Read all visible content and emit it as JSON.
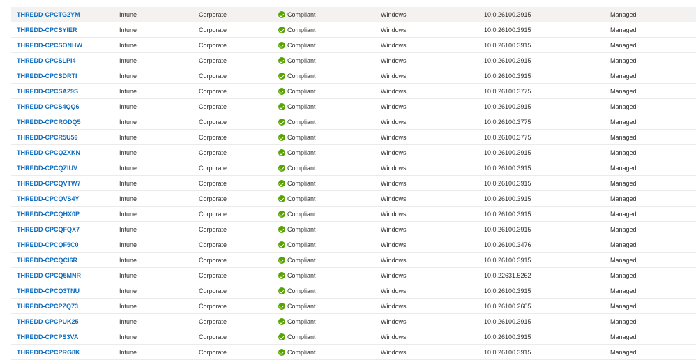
{
  "colors": {
    "link": "#0f6cbd",
    "compliant": "#57a300",
    "selected_row": "#f3f2f1"
  },
  "status_icon": "check-circle-icon",
  "rows": [
    {
      "name": "THREDD-CPCTG2YM",
      "management": "Intune",
      "ownership": "Corporate",
      "compliance": "Compliant",
      "os": "Windows",
      "os_version": "10.0.26100.3915",
      "state": "Managed"
    },
    {
      "name": "THREDD-CPCSYIER",
      "management": "Intune",
      "ownership": "Corporate",
      "compliance": "Compliant",
      "os": "Windows",
      "os_version": "10.0.26100.3915",
      "state": "Managed"
    },
    {
      "name": "THREDD-CPCSONHW",
      "management": "Intune",
      "ownership": "Corporate",
      "compliance": "Compliant",
      "os": "Windows",
      "os_version": "10.0.26100.3915",
      "state": "Managed"
    },
    {
      "name": "THREDD-CPCSLPI4",
      "management": "Intune",
      "ownership": "Corporate",
      "compliance": "Compliant",
      "os": "Windows",
      "os_version": "10.0.26100.3915",
      "state": "Managed"
    },
    {
      "name": "THREDD-CPCSDRTI",
      "management": "Intune",
      "ownership": "Corporate",
      "compliance": "Compliant",
      "os": "Windows",
      "os_version": "10.0.26100.3915",
      "state": "Managed"
    },
    {
      "name": "THREDD-CPCSA29S",
      "management": "Intune",
      "ownership": "Corporate",
      "compliance": "Compliant",
      "os": "Windows",
      "os_version": "10.0.26100.3775",
      "state": "Managed"
    },
    {
      "name": "THREDD-CPCS4QQ6",
      "management": "Intune",
      "ownership": "Corporate",
      "compliance": "Compliant",
      "os": "Windows",
      "os_version": "10.0.26100.3915",
      "state": "Managed"
    },
    {
      "name": "THREDD-CPCRODQ5",
      "management": "Intune",
      "ownership": "Corporate",
      "compliance": "Compliant",
      "os": "Windows",
      "os_version": "10.0.26100.3775",
      "state": "Managed"
    },
    {
      "name": "THREDD-CPCR5U59",
      "management": "Intune",
      "ownership": "Corporate",
      "compliance": "Compliant",
      "os": "Windows",
      "os_version": "10.0.26100.3775",
      "state": "Managed"
    },
    {
      "name": "THREDD-CPCQZXKN",
      "management": "Intune",
      "ownership": "Corporate",
      "compliance": "Compliant",
      "os": "Windows",
      "os_version": "10.0.26100.3915",
      "state": "Managed"
    },
    {
      "name": "THREDD-CPCQZIUV",
      "management": "Intune",
      "ownership": "Corporate",
      "compliance": "Compliant",
      "os": "Windows",
      "os_version": "10.0.26100.3915",
      "state": "Managed"
    },
    {
      "name": "THREDD-CPCQVTW7",
      "management": "Intune",
      "ownership": "Corporate",
      "compliance": "Compliant",
      "os": "Windows",
      "os_version": "10.0.26100.3915",
      "state": "Managed"
    },
    {
      "name": "THREDD-CPCQVS4Y",
      "management": "Intune",
      "ownership": "Corporate",
      "compliance": "Compliant",
      "os": "Windows",
      "os_version": "10.0.26100.3915",
      "state": "Managed"
    },
    {
      "name": "THREDD-CPCQHX0P",
      "management": "Intune",
      "ownership": "Corporate",
      "compliance": "Compliant",
      "os": "Windows",
      "os_version": "10.0.26100.3915",
      "state": "Managed"
    },
    {
      "name": "THREDD-CPCQFQX7",
      "management": "Intune",
      "ownership": "Corporate",
      "compliance": "Compliant",
      "os": "Windows",
      "os_version": "10.0.26100.3915",
      "state": "Managed"
    },
    {
      "name": "THREDD-CPCQF5C0",
      "management": "Intune",
      "ownership": "Corporate",
      "compliance": "Compliant",
      "os": "Windows",
      "os_version": "10.0.26100.3476",
      "state": "Managed"
    },
    {
      "name": "THREDD-CPCQCI6R",
      "management": "Intune",
      "ownership": "Corporate",
      "compliance": "Compliant",
      "os": "Windows",
      "os_version": "10.0.26100.3915",
      "state": "Managed"
    },
    {
      "name": "THREDD-CPCQ5MNR",
      "management": "Intune",
      "ownership": "Corporate",
      "compliance": "Compliant",
      "os": "Windows",
      "os_version": "10.0.22631.5262",
      "state": "Managed"
    },
    {
      "name": "THREDD-CPCQ3TNU",
      "management": "Intune",
      "ownership": "Corporate",
      "compliance": "Compliant",
      "os": "Windows",
      "os_version": "10.0.26100.3915",
      "state": "Managed"
    },
    {
      "name": "THREDD-CPCPZQ73",
      "management": "Intune",
      "ownership": "Corporate",
      "compliance": "Compliant",
      "os": "Windows",
      "os_version": "10.0.26100.2605",
      "state": "Managed"
    },
    {
      "name": "THREDD-CPCPUK25",
      "management": "Intune",
      "ownership": "Corporate",
      "compliance": "Compliant",
      "os": "Windows",
      "os_version": "10.0.26100.3915",
      "state": "Managed"
    },
    {
      "name": "THREDD-CPCPS3VA",
      "management": "Intune",
      "ownership": "Corporate",
      "compliance": "Compliant",
      "os": "Windows",
      "os_version": "10.0.26100.3915",
      "state": "Managed"
    },
    {
      "name": "THREDD-CPCPRG8K",
      "management": "Intune",
      "ownership": "Corporate",
      "compliance": "Compliant",
      "os": "Windows",
      "os_version": "10.0.26100.3915",
      "state": "Managed"
    }
  ]
}
